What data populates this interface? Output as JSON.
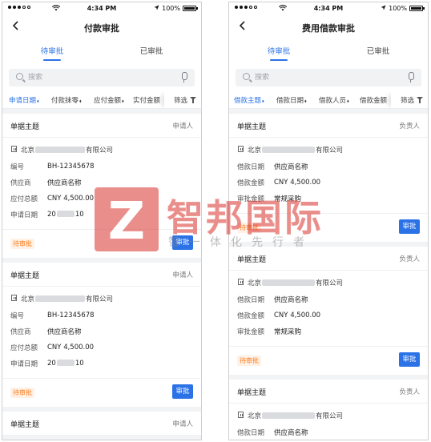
{
  "statusbar": {
    "time": "4:34 PM",
    "battery": "100%"
  },
  "left": {
    "title": "付款审批",
    "tabs": [
      "待审批",
      "已审批"
    ],
    "search_placeholder": "搜索",
    "filters": [
      {
        "label": "申请日期",
        "caret": "⬧"
      },
      {
        "label": "付款抹零",
        "caret": "⬧"
      },
      {
        "label": "应付金额",
        "caret": "⬧"
      },
      {
        "label": "实付金额",
        "caret": ""
      }
    ],
    "screen_label": "筛选",
    "cards": [
      {
        "subject": "单据主题",
        "role": "申请人",
        "company_prefix": "北京",
        "company_suffix": "有限公司",
        "rows": [
          {
            "k": "编号",
            "v": "BH-12345678"
          },
          {
            "k": "供应商",
            "v": "供应商名称"
          },
          {
            "k": "应付总额",
            "v": "CNY 4,500.00"
          },
          {
            "k": "申请日期",
            "v_prefix": "20",
            "v_suffix": "10"
          }
        ],
        "status": "待审批",
        "action": "审批"
      },
      {
        "subject": "单据主题",
        "role": "申请人",
        "company_prefix": "北京",
        "company_suffix": "有限公司",
        "rows": [
          {
            "k": "编号",
            "v": "BH-12345678"
          },
          {
            "k": "供应商",
            "v": "供应商名称"
          },
          {
            "k": "应付总额",
            "v": "CNY 4,500.00"
          },
          {
            "k": "申请日期",
            "v_prefix": "20",
            "v_suffix": "10"
          }
        ],
        "status": "待审批",
        "action": "审批"
      },
      {
        "subject": "单据主题",
        "role": "申请人"
      }
    ]
  },
  "right": {
    "title": "费用借款审批",
    "tabs": [
      "待审批",
      "已审批"
    ],
    "search_placeholder": "搜索",
    "filters": [
      {
        "label": "借款主题",
        "caret": "⬧"
      },
      {
        "label": "借款日期",
        "caret": "⬧"
      },
      {
        "label": "借款人员",
        "caret": "⬧"
      },
      {
        "label": "借款金额",
        "caret": ""
      }
    ],
    "screen_label": "筛选",
    "cards": [
      {
        "subject": "单据主题",
        "role": "负责人",
        "company_prefix": "北京",
        "company_suffix": "有限公司",
        "rows": [
          {
            "k": "借款日期",
            "v": "供应商名称"
          },
          {
            "k": "借款金额",
            "v": "CNY 4,500.00"
          },
          {
            "k": "审批金额",
            "v": "常规采购"
          }
        ],
        "status": "待审批",
        "action": "审批"
      },
      {
        "subject": "单据主题",
        "role": "负责人",
        "company_prefix": "北京",
        "company_suffix": "有限公司",
        "rows": [
          {
            "k": "借款日期",
            "v": "供应商名称"
          },
          {
            "k": "借款金额",
            "v": "CNY 4,500.00"
          },
          {
            "k": "审批金额",
            "v": "常规采购"
          }
        ],
        "status": "待审批",
        "action": "审批"
      },
      {
        "subject": "单据主题",
        "role": "负责人",
        "company_prefix": "北京",
        "company_suffix": "有限公司",
        "rows": [
          {
            "k": "借款日期",
            "v": "供应商名称"
          }
        ]
      }
    ]
  },
  "watermark": {
    "name": "智邦国际",
    "slogan": "智一体化先行者"
  },
  "colors": {
    "accent": "#2b72e6",
    "pending": "#ff7a1a",
    "watermark": "#d9322e"
  }
}
